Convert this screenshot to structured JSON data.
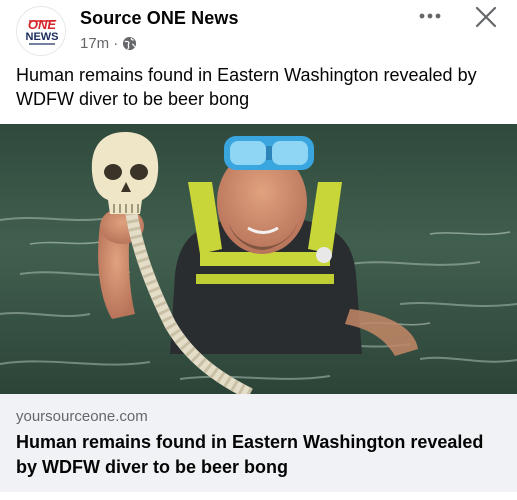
{
  "post": {
    "page_name": "Source ONE News",
    "timestamp": "17m",
    "separator": "·",
    "audience_icon": "globe-icon",
    "text": "Human remains found in Eastern Washington revealed by WDFW diver to be beer bong",
    "logo": {
      "line1": "ONE",
      "line2": "NEWS",
      "colors": {
        "red": "#d7262b",
        "navy": "#1a2b5e"
      }
    },
    "actions": {
      "more_icon": "more-horizontal-icon",
      "close_icon": "close-icon"
    }
  },
  "link_preview": {
    "domain": "yoursourceone.com",
    "title": "Human remains found in Eastern Washington revealed by WDFW diver to be beer bong"
  },
  "colors": {
    "secondary_text": "#65676b",
    "primary_text": "#050505",
    "card_bg": "#f0f2f5",
    "water": "#3d5a4a"
  }
}
